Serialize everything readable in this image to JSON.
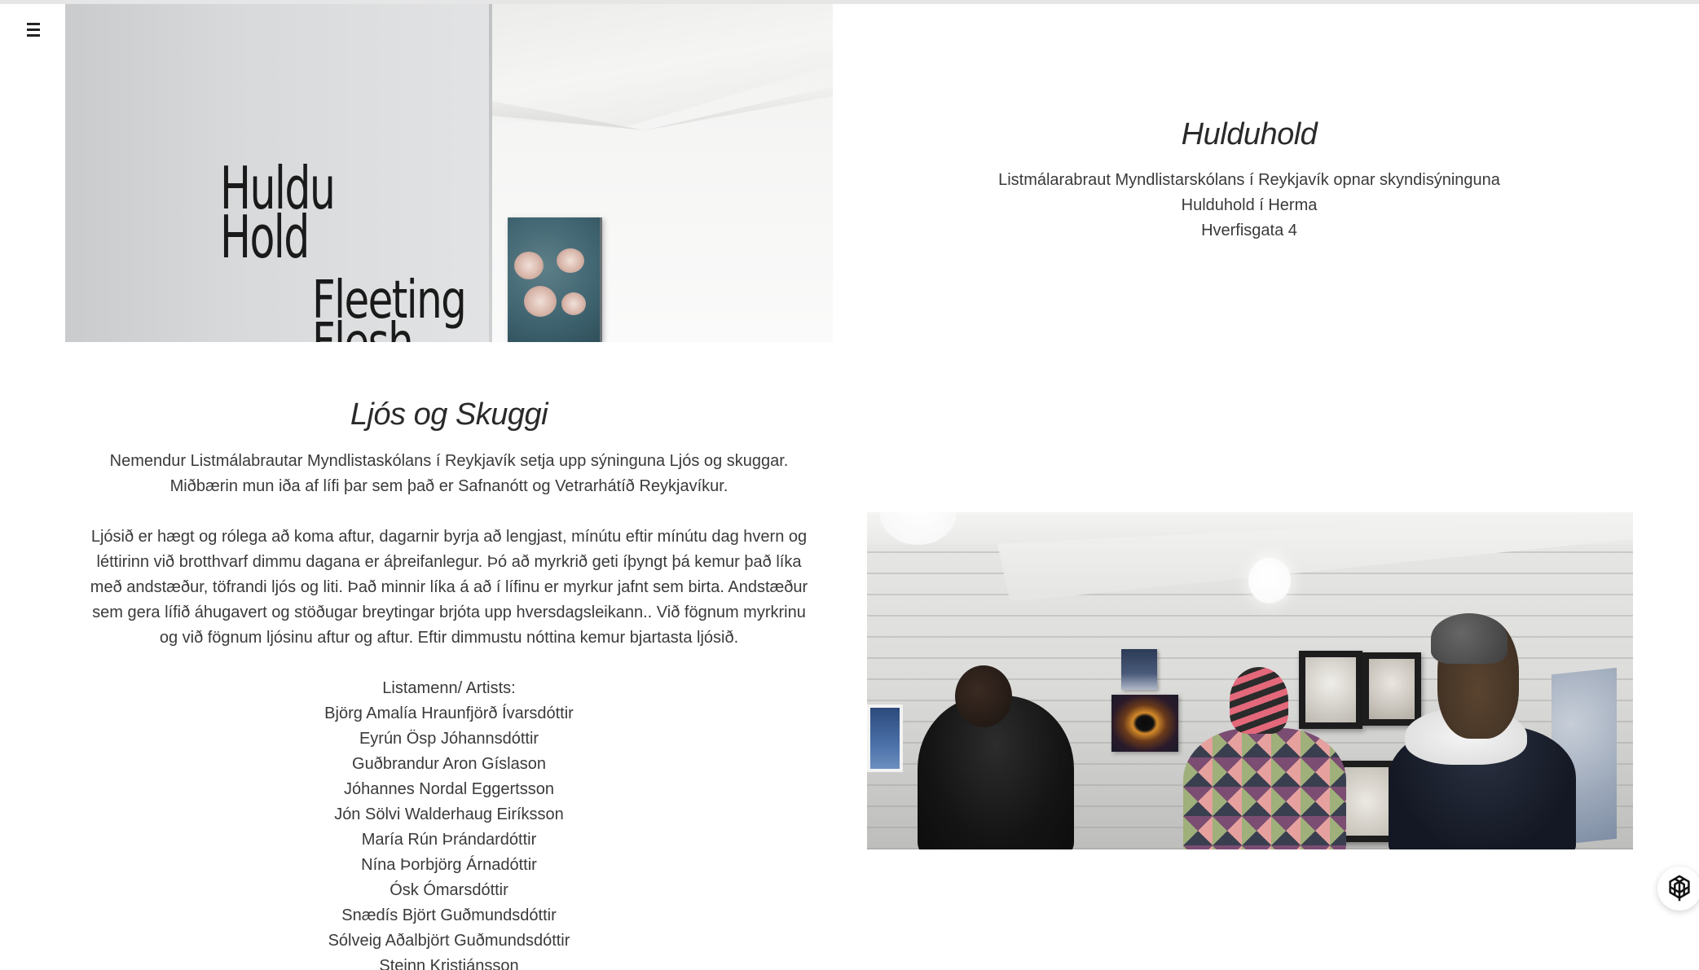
{
  "nav": {
    "menu_icon": "hamburger-menu-icon"
  },
  "hero_image": {
    "wall_text_line1": "Huldu",
    "wall_text_line2": "Hold",
    "wall_text_line3": "Fleeting",
    "wall_text_line4": "Flesh"
  },
  "section1": {
    "title": "Hulduhold",
    "lines": [
      "Listmálarabraut Myndlistarskólans í Reykjavík opnar skyndisýninguna",
      "Hulduhold í Herma",
      "Hverfisgata 4"
    ]
  },
  "section2": {
    "title": "Ljós og Skuggi",
    "intro": [
      "Nemendur Listmálabrautar Myndlistaskólans í Reykjavík setja upp sýninguna Ljós og skuggar.",
      "Miðbærin mun iða af lífi þar sem það er Safnanótt og Vetrarhátíð Reykjavíkur."
    ],
    "body": [
      "Ljósið er hægt og rólega að koma aftur, dagarnir byrja að lengjast, mínútu eftir mínútu dag hvern og",
      "léttirinn við brotthvarf dimmu dagana er áþreifanlegur. Þó að myrkrið geti íþyngt þá kemur það líka",
      "með andstæður, töfrandi ljós og liti. Það minnir líka á að í lífinu er myrkur jafnt sem birta. Andstæður",
      "sem gera lífið áhugavert og stöðugar breytingar brjóta upp hversdagsleikann.. Við fögnum myrkrinu",
      "og við fögnum ljósinu aftur og aftur. Eftir dimmustu nóttina kemur bjartasta ljósið."
    ],
    "artists_heading": "Listamenn/ Artists:",
    "artists": [
      "Björg Amalía Hraunfjörð Ívarsdóttir",
      "Eyrún Ösp Jóhannsdóttir",
      "Guðbrandur Aron Gíslason",
      "Jóhannes Nordal Eggertsson",
      "Jón Sölvi Walderhaug Eiríksson",
      "María Rún Þrándardóttir",
      "Nína Þorbjörg Árnadóttir",
      "Ósk Ómarsdóttir",
      "Snædís Björt Guðmundsdóttir",
      "Sólveig Aðalbjört Guðmundsdóttir",
      "Steinn Kristjánsson"
    ]
  },
  "widget": {
    "icon": "assistant-knot-icon"
  }
}
